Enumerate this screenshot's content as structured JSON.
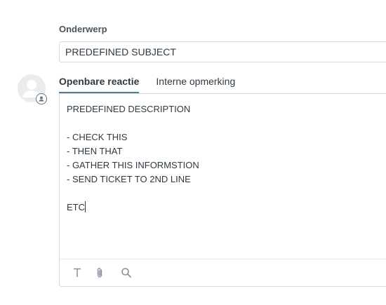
{
  "subject": {
    "label": "Onderwerp",
    "value": "PREDEFINED SUBJECT"
  },
  "tabs": [
    {
      "label": "Openbare reactie",
      "active": true
    },
    {
      "label": "Interne opmerking",
      "active": false
    }
  ],
  "editor": {
    "lines": [
      "PREDEFINED DESCRIPTION",
      "",
      "- CHECK THIS",
      "- THEN THAT",
      "- GATHER THIS INFORMSTION",
      "- SEND TICKET TO 2ND LINE",
      "",
      "ETC"
    ]
  },
  "toolbar": {
    "icons": [
      "text-format-icon",
      "paperclip-icon",
      "search-icon"
    ]
  },
  "colors": {
    "active_tab_underline": "#4a7f9c",
    "border": "#d8dcde",
    "icon": "#87929d"
  }
}
